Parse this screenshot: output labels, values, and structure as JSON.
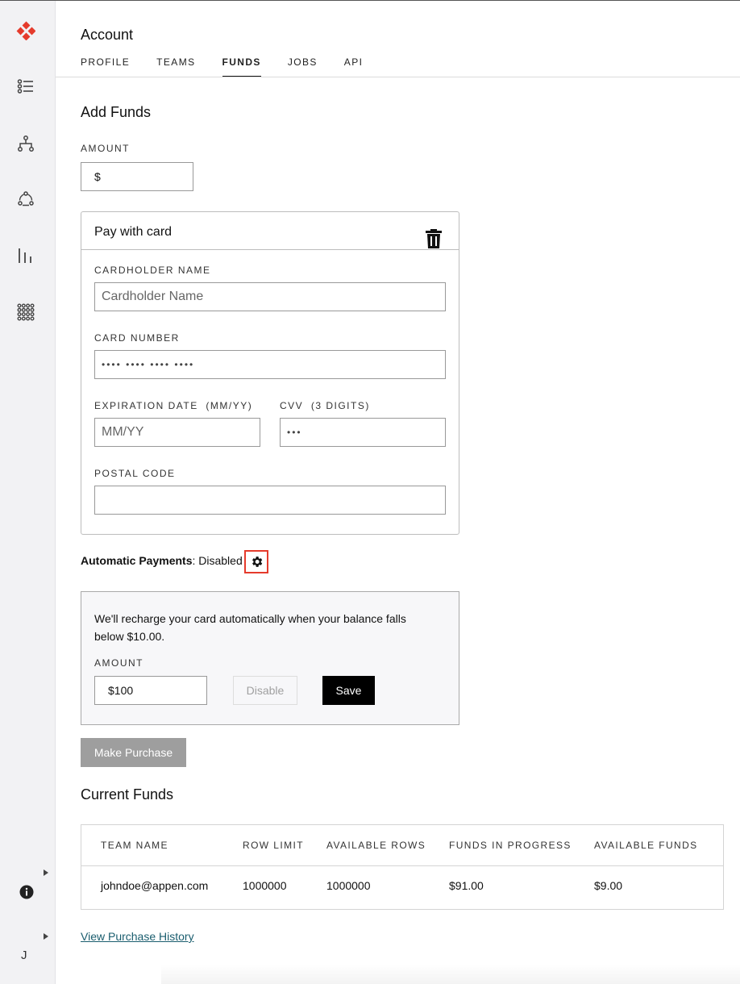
{
  "header": {
    "title": "Account",
    "tabs": [
      {
        "label": "PROFILE",
        "active": false
      },
      {
        "label": "TEAMS",
        "active": false
      },
      {
        "label": "FUNDS",
        "active": true
      },
      {
        "label": "JOBS",
        "active": false
      },
      {
        "label": "API",
        "active": false
      }
    ]
  },
  "sidebar": {
    "icons": [
      "logo-icon",
      "list-icon",
      "hierarchy-icon",
      "workflow-icon",
      "bar-chart-icon",
      "apps-grid-icon",
      "info-icon"
    ],
    "user_initial": "J",
    "brand_color": "#e53b2c"
  },
  "add_funds": {
    "heading": "Add Funds",
    "amount_label": "AMOUNT",
    "amount_value": "$"
  },
  "card": {
    "title": "Pay with card",
    "cardholder_label": "CARDHOLDER NAME",
    "cardholder_placeholder": "Cardholder Name",
    "card_number_label": "CARD NUMBER",
    "card_number_placeholder": "•••• •••• •••• ••••",
    "expiration_label": "EXPIRATION DATE  (MM/YY)",
    "expiration_placeholder": "MM/YY",
    "cvv_label": "CVV  (3 DIGITS)",
    "cvv_placeholder": "•••",
    "postal_label": "POSTAL CODE",
    "postal_value": ""
  },
  "auto_payments": {
    "label": "Automatic Payments",
    "status": ": Disabled",
    "description": "We'll recharge your card automatically when your balance falls below $10.00.",
    "amount_label": "AMOUNT",
    "amount_value": "$100",
    "disable_label": "Disable",
    "save_label": "Save"
  },
  "purchase_button": "Make Purchase",
  "current_funds": {
    "heading": "Current Funds",
    "columns": [
      "TEAM NAME",
      "ROW LIMIT",
      "AVAILABLE ROWS",
      "FUNDS IN PROGRESS",
      "AVAILABLE FUNDS"
    ],
    "rows": [
      [
        "johndoe@appen.com",
        "1000000",
        "1000000",
        "$91.00",
        "$9.00"
      ]
    ]
  },
  "history_link": "View Purchase History"
}
